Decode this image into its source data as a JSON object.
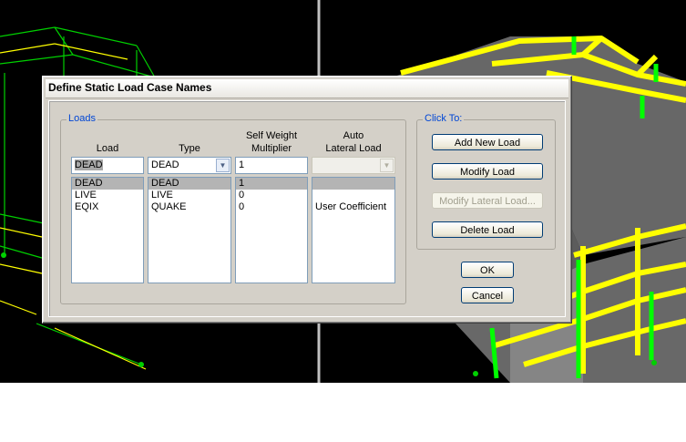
{
  "dialog": {
    "title": "Define Static Load Case Names"
  },
  "loads_group": {
    "legend": "Loads",
    "headers": {
      "load": "Load",
      "type": "Type",
      "self_weight_1": "Self Weight",
      "self_weight_2": "Multiplier",
      "auto_1": "Auto",
      "auto_2": "Lateral Load"
    },
    "inputs": {
      "load_name": "DEAD",
      "type": "DEAD",
      "multiplier": "1",
      "auto_lateral": ""
    },
    "rows": [
      {
        "load": "DEAD",
        "type": "DEAD",
        "multiplier": "1",
        "auto": ""
      },
      {
        "load": "LIVE",
        "type": "LIVE",
        "multiplier": "0",
        "auto": ""
      },
      {
        "load": "EQIX",
        "type": "QUAKE",
        "multiplier": "0",
        "auto": "User Coefficient"
      }
    ],
    "selected_row": 0
  },
  "click_to_group": {
    "legend": "Click To:",
    "add_new_load": "Add New Load",
    "modify_load": "Modify Load",
    "modify_lateral_load": "Modify Lateral Load...",
    "delete_load": "Delete Load"
  },
  "buttons": {
    "ok": "OK",
    "cancel": "Cancel"
  },
  "colors": {
    "accent": "#0046d5",
    "frame_yellow": "#ffff00",
    "frame_green": "#00ff00"
  }
}
